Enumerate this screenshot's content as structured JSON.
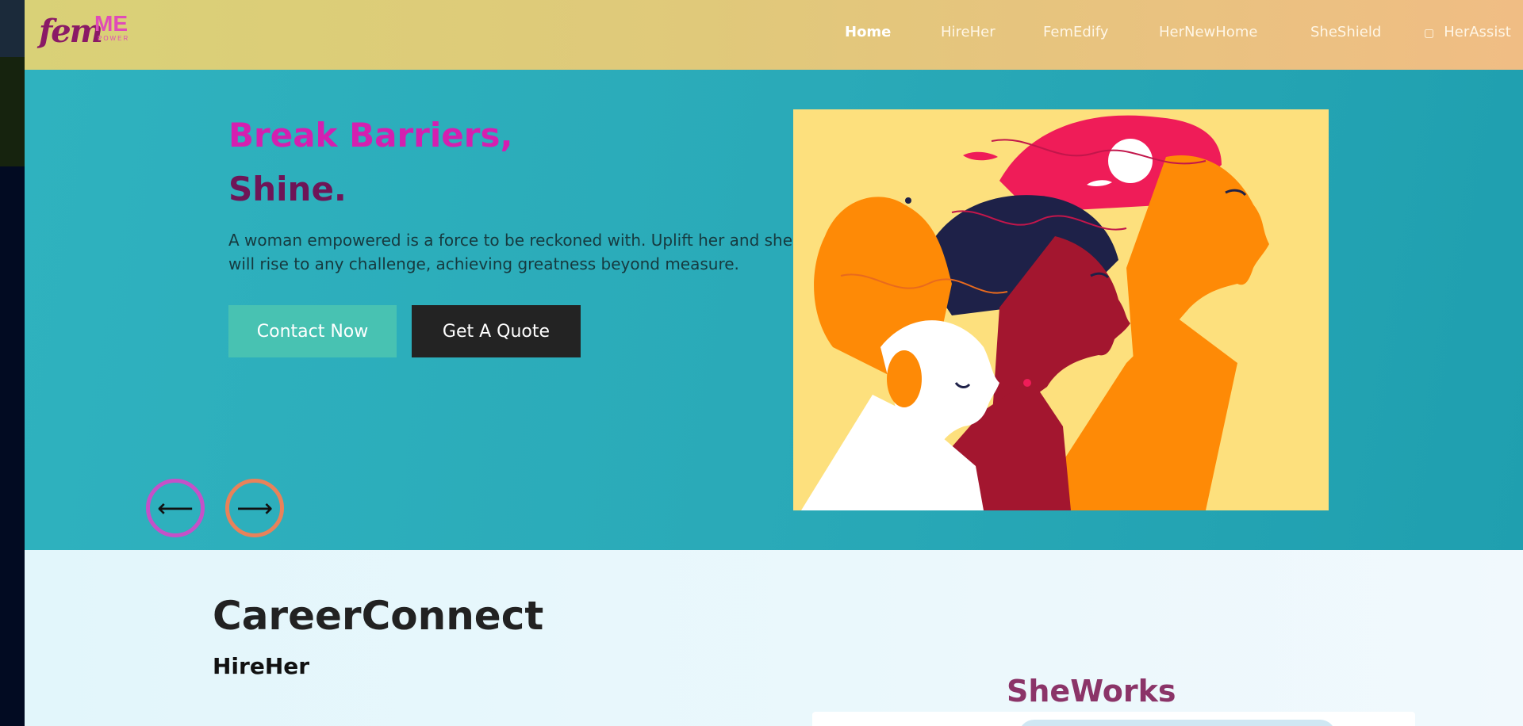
{
  "logo": {
    "primary": "fem",
    "secondary": "ME",
    "tagline": "POWER"
  },
  "nav": {
    "items": [
      {
        "label": "Home",
        "active": true
      },
      {
        "label": "HireHer",
        "active": false
      },
      {
        "label": "FemEdify",
        "active": false
      },
      {
        "label": "HerNewHome",
        "active": false
      },
      {
        "label": "SheShield",
        "active": false
      },
      {
        "label": "HerAssist",
        "active": false,
        "icon": "assist-icon"
      }
    ]
  },
  "hero": {
    "title_line1": "Break Barriers,",
    "title_line2": "Shine.",
    "description": "A woman empowered is a force to be reckoned with. Uplift her and she will rise to any challenge, achieving greatness beyond measure.",
    "contact_button": "Contact Now",
    "quote_button": "Get A Quote",
    "prev_arrow": "⟵",
    "next_arrow": "⟶",
    "image_icon": "women-profiles-illustration"
  },
  "career": {
    "title": "CareerConnect",
    "subtitle": "HireHer"
  },
  "sheworks": {
    "title": "SheWorks"
  },
  "colors": {
    "accent_pink": "#d41fb0",
    "accent_plum": "#6e1557",
    "hero_teal": "#2aaab8",
    "contact_button": "#48c2b2",
    "quote_button": "#232323"
  }
}
